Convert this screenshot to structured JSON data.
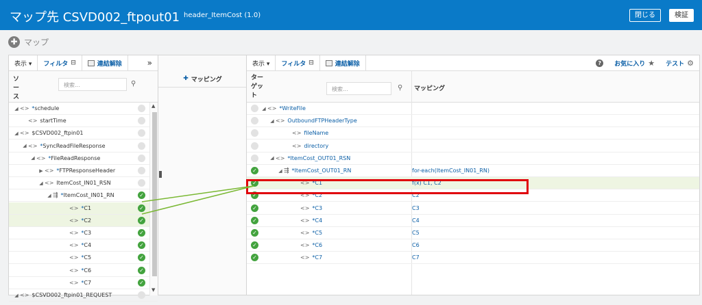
{
  "header": {
    "title": "マップ先 CSVD002_ftpout01",
    "subtitle": "header_ItemCost (1.0)",
    "close_label": "閉じる",
    "validate_label": "検証"
  },
  "breadcrumb": {
    "label": "マップ"
  },
  "source": {
    "toolbar": {
      "view": "表示 ▾",
      "filter": "フィルタ",
      "unlink": "連結解除",
      "collapse": "»"
    },
    "column_label": "ソース",
    "search_placeholder": "検索...",
    "rows": [
      {
        "indent": 0,
        "tri": "◢",
        "tag": "<>",
        "star": "*",
        "label": "schedule",
        "status": "empty"
      },
      {
        "indent": 1,
        "tri": "",
        "tag": "<>",
        "star": "",
        "label": "startTime",
        "status": "empty"
      },
      {
        "indent": 0,
        "tri": "◢",
        "tag": "<>",
        "star": "",
        "label": "$CSVD002_ftpin01",
        "status": "empty"
      },
      {
        "indent": 1,
        "tri": "◢",
        "tag": "<>",
        "star": "*",
        "label": "SyncReadFileResponse",
        "status": "empty"
      },
      {
        "indent": 2,
        "tri": "◢",
        "tag": "<>",
        "star": "*",
        "label": "FileReadResponse",
        "status": "empty"
      },
      {
        "indent": 3,
        "tri": "▶",
        "tag": "<>",
        "star": "*",
        "label": "FTPResponseHeader",
        "status": "empty"
      },
      {
        "indent": 3,
        "tri": "◢",
        "tag": "<>",
        "star": "",
        "label": "ItemCost_IN01_RSN",
        "status": "empty"
      },
      {
        "indent": 4,
        "tri": "◢",
        "tag": "rep",
        "star": "*",
        "label": "ItemCost_IN01_RN",
        "status": "ok"
      },
      {
        "indent": 6,
        "tri": "",
        "tag": "<>",
        "star": "*",
        "label": "C1",
        "status": "ok",
        "hl": true
      },
      {
        "indent": 6,
        "tri": "",
        "tag": "<>",
        "star": "*",
        "label": "C2",
        "status": "ok",
        "hl": true
      },
      {
        "indent": 6,
        "tri": "",
        "tag": "<>",
        "star": "*",
        "label": "C3",
        "status": "ok"
      },
      {
        "indent": 6,
        "tri": "",
        "tag": "<>",
        "star": "*",
        "label": "C4",
        "status": "ok"
      },
      {
        "indent": 6,
        "tri": "",
        "tag": "<>",
        "star": "*",
        "label": "C5",
        "status": "ok"
      },
      {
        "indent": 6,
        "tri": "",
        "tag": "<>",
        "star": "*",
        "label": "C6",
        "status": "ok"
      },
      {
        "indent": 6,
        "tri": "",
        "tag": "<>",
        "star": "*",
        "label": "C7",
        "status": "ok"
      },
      {
        "indent": 0,
        "tri": "◢",
        "tag": "<>",
        "star": "",
        "label": "$CSVD002_ftpin01_REQUEST",
        "status": "empty"
      }
    ]
  },
  "middle": {
    "label": "マッピング"
  },
  "target": {
    "toolbar": {
      "view": "表示 ▾",
      "filter": "フィルタ",
      "unlink": "連結解除",
      "help": "?",
      "favorites": "お気に入り",
      "test": "テスト"
    },
    "column_label": "ター\nゲッ\nト",
    "search_placeholder": "検索...",
    "mapping_header": "マッピング",
    "rows": [
      {
        "indent": 0,
        "tri": "◢",
        "tag": "<>",
        "star": "*",
        "label": "WriteFile",
        "status": "empty",
        "mapping": ""
      },
      {
        "indent": 1,
        "tri": "◢",
        "tag": "<>",
        "star": "",
        "label": "OutboundFTPHeaderType",
        "status": "empty",
        "mapping": ""
      },
      {
        "indent": 3,
        "tri": "",
        "tag": "<>",
        "star": "",
        "label": "fileName",
        "status": "empty",
        "mapping": ""
      },
      {
        "indent": 3,
        "tri": "",
        "tag": "<>",
        "star": "",
        "label": "directory",
        "status": "empty",
        "mapping": ""
      },
      {
        "indent": 1,
        "tri": "◢",
        "tag": "<>",
        "star": "*",
        "label": "ItemCost_OUT01_RSN",
        "status": "empty",
        "mapping": ""
      },
      {
        "indent": 2,
        "tri": "◢",
        "tag": "rep",
        "star": "*",
        "label": "ItemCost_OUT01_RN",
        "status": "ok",
        "mapping": "for-each(ItemCost_IN01_RN)"
      },
      {
        "indent": 4,
        "tri": "",
        "tag": "<>",
        "star": "*",
        "label": "C1",
        "status": "ok",
        "mapping": "f(x) C1, C2",
        "hl": true
      },
      {
        "indent": 4,
        "tri": "",
        "tag": "<>",
        "star": "*",
        "label": "C2",
        "status": "ok",
        "mapping": "C2"
      },
      {
        "indent": 4,
        "tri": "",
        "tag": "<>",
        "star": "*",
        "label": "C3",
        "status": "ok",
        "mapping": "C3"
      },
      {
        "indent": 4,
        "tri": "",
        "tag": "<>",
        "star": "*",
        "label": "C4",
        "status": "ok",
        "mapping": "C4"
      },
      {
        "indent": 4,
        "tri": "",
        "tag": "<>",
        "star": "*",
        "label": "C5",
        "status": "ok",
        "mapping": "C5"
      },
      {
        "indent": 4,
        "tri": "",
        "tag": "<>",
        "star": "*",
        "label": "C6",
        "status": "ok",
        "mapping": "C6"
      },
      {
        "indent": 4,
        "tri": "",
        "tag": "<>",
        "star": "*",
        "label": "C7",
        "status": "ok",
        "mapping": "C7"
      }
    ]
  },
  "colors": {
    "header_bg": "#0a7ac8",
    "link": "#0a5ea6",
    "status_ok": "#43a33e",
    "mapping_line": "#7ab833",
    "callout": "#e0000b",
    "row_highlight": "#eef5e2"
  }
}
